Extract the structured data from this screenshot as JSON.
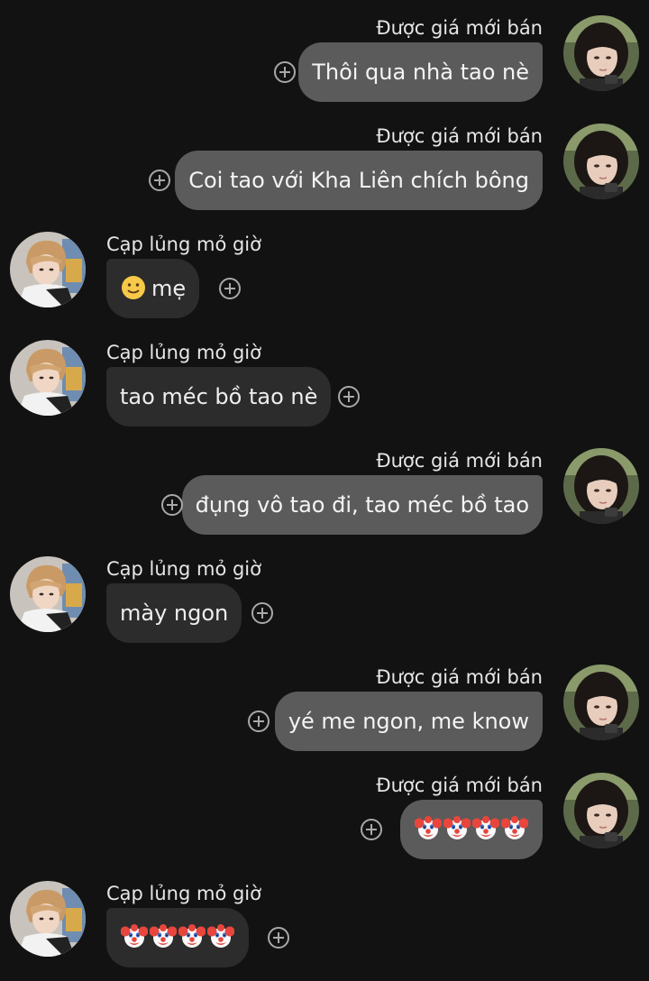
{
  "participants": {
    "outgoing_name": "Được giá mới bán",
    "incoming_name": "Cạp lủng mỏ giờ"
  },
  "messages": [
    {
      "side": "out",
      "sender": "Được giá mới bán",
      "text": "Thôi qua nhà tao nè"
    },
    {
      "side": "out",
      "sender": "Được giá mới bán",
      "text": "Coi tao với Kha Liên chích bông"
    },
    {
      "side": "in",
      "sender": "Cạp lủng mỏ giờ",
      "text": "mẹ",
      "emoji": "slightly-smiling-face"
    },
    {
      "side": "in",
      "sender": "Cạp lủng mỏ giờ",
      "text": "tao méc bồ tao nè"
    },
    {
      "side": "out",
      "sender": "Được giá mới bán",
      "text": "đụng vô tao đi, tao méc bồ tao"
    },
    {
      "side": "in",
      "sender": "Cạp lủng mỏ giờ",
      "text": "mày ngon"
    },
    {
      "side": "out",
      "sender": "Được giá mới bán",
      "text": "yé me ngon, me know"
    },
    {
      "side": "out",
      "sender": "Được giá mới bán",
      "text": "",
      "emoji": "clown-face",
      "emoji_count": 4
    },
    {
      "side": "in",
      "sender": "Cạp lủng mỏ giờ",
      "text": "",
      "emoji": "clown-face",
      "emoji_count": 4
    }
  ],
  "icons": {
    "reaction": "add-reaction-icon",
    "outgoing_avatar": "avatar-photo-girl-dark-hair",
    "incoming_avatar": "avatar-photo-blond-hair"
  },
  "colors": {
    "background": "#121212",
    "outgoing_bubble": "#5b5b5b",
    "incoming_bubble": "#2c2c2c",
    "text": "#f4f4f4"
  }
}
